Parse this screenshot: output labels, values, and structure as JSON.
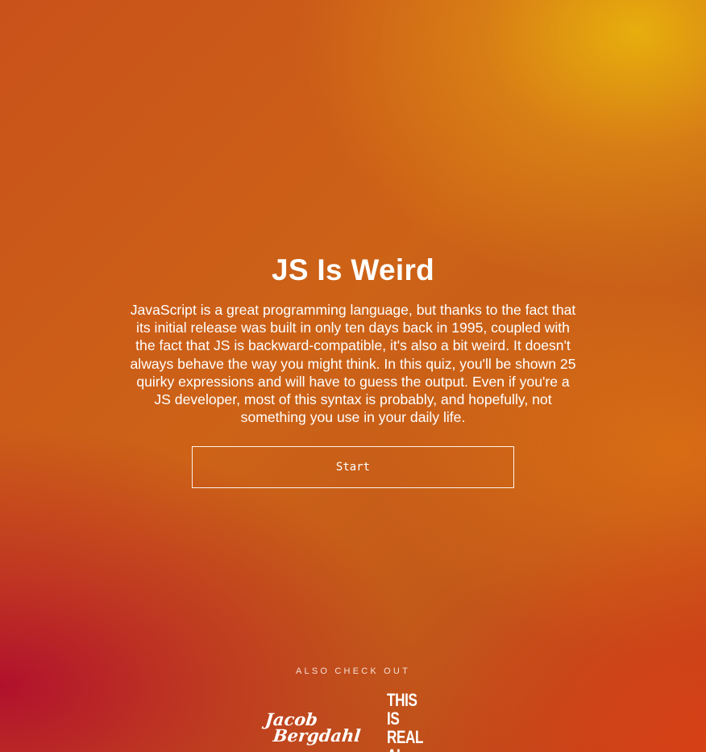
{
  "hero": {
    "title": "JS Is Weird",
    "description": "JavaScript is a great programming language, but thanks to the fact that its initial release was built in only ten days back in 1995, coupled with the fact that JS is backward-compatible, it's also a bit weird. It doesn't always behave the way you might think. In this quiz, you'll be shown 25 quirky expressions and will have to guess the output. Even if you're a JS developer, most of this syntax is probably, and hopefully, not something you use in your daily life.",
    "start_label": "Start"
  },
  "footer": {
    "also_label": "ALSO CHECK OUT",
    "logos": [
      {
        "line1": "Jacob",
        "line2": "Bergdahl"
      },
      {
        "line1": "THIS IS",
        "line2": "REAL AI"
      }
    ]
  },
  "colors": {
    "top_right": "#e5a80d",
    "center": "#cb5d18",
    "bottom_left": "#b00e2e",
    "bottom_right": "#dc4416",
    "text": "#ffffff"
  }
}
